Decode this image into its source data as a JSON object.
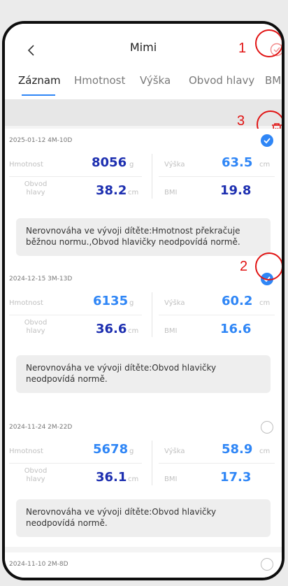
{
  "header": {
    "title": "Mimi"
  },
  "tabs": [
    "Záznam",
    "Hmotnost",
    "Výška",
    "Obvod hlavy",
    "BMI"
  ],
  "labels": {
    "weight": "Hmotnost",
    "height": "Výška",
    "head": "Obvod hlavy",
    "bmi": "BMI"
  },
  "annotations": [
    "1",
    "2",
    "3"
  ],
  "records": [
    {
      "date": "2025-01-12 4M-10D",
      "weight": "8056",
      "weight_unit": "g",
      "height": "63.5",
      "height_unit": "cm",
      "head": "38.2",
      "head_unit": "cm",
      "bmi": "19.8",
      "note": "Nerovnováha ve vývoji dítěte:Hmotnost překračuje běžnou normu.,Obvod hlavičky neodpovídá normě.",
      "selected": true
    },
    {
      "date": "2024-12-15 3M-13D",
      "weight": "6135",
      "weight_unit": "g",
      "height": "60.2",
      "height_unit": "cm",
      "head": "36.6",
      "head_unit": "cm",
      "bmi": "16.6",
      "note": "Nerovnováha ve vývoji dítěte:Obvod hlavičky neodpovídá normě.",
      "selected": true
    },
    {
      "date": "2024-11-24 2M-22D",
      "weight": "5678",
      "weight_unit": "g",
      "height": "58.9",
      "height_unit": "cm",
      "head": "36.1",
      "head_unit": "cm",
      "bmi": "17.3",
      "note": "Nerovnováha ve vývoji dítěte:Obvod hlavičky neodpovídá normě.",
      "selected": false
    },
    {
      "date": "2024-11-10 2M-8D",
      "selected": false
    }
  ],
  "colors": {
    "accent": "#2f86f6",
    "annotation": "#e11414",
    "value_dark": "#1d2fb0",
    "value_light": "#2f86f6"
  }
}
